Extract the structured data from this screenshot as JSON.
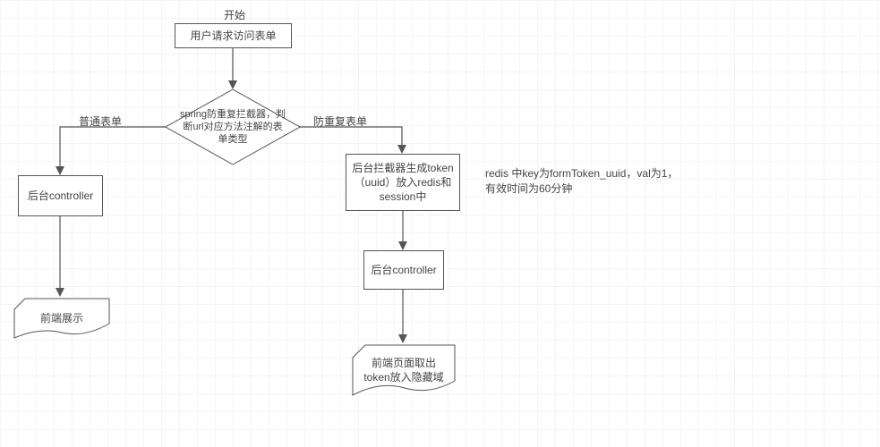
{
  "diagram": {
    "start_label": "开始",
    "start_node": "用户请求访问表单",
    "decision": "spring防重复拦截器，判断url对应方法注解的表单类型",
    "left_branch_label": "普通表单",
    "right_branch_label": "防重复表单",
    "left_controller": "后台controller",
    "left_display": "前端展示",
    "right_process": "后台拦截器生成token（uuid）放入redis和session中",
    "right_annotation": "redis 中key为formToken_uuid，val为1，有效时间为60分钟",
    "right_controller": "后台controller",
    "right_display": "前端页面取出token放入隐藏域"
  }
}
